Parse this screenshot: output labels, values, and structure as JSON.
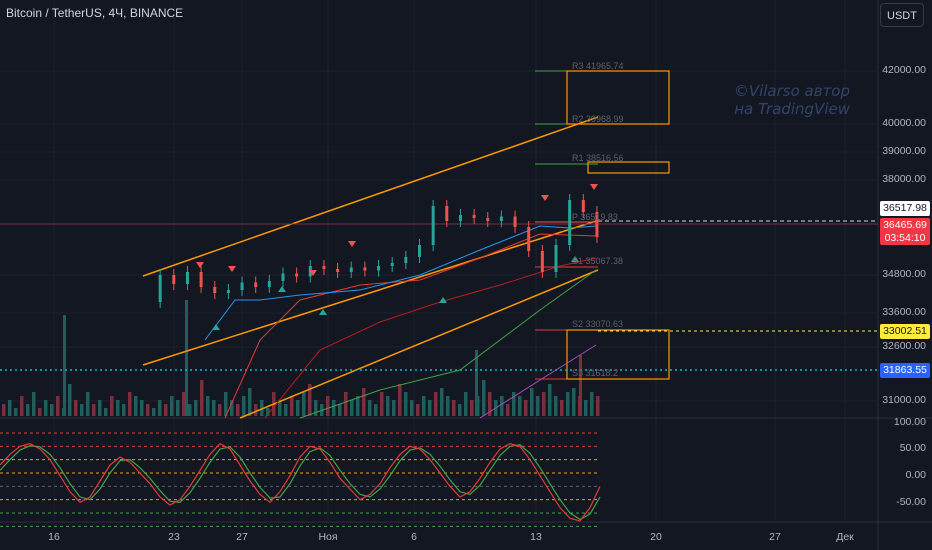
{
  "header": {
    "symbol": "Bitcoin / TetherUS, 4Ч, BINANCE",
    "currency": "USDT"
  },
  "watermark": {
    "line1": "©Vilarso автор",
    "line2": "на TradingView"
  },
  "price_axis": {
    "ticks": [
      "42000.00",
      "40000.00",
      "39000.00",
      "38000.00",
      "34800.00",
      "33600.00",
      "32600.00",
      "31000.00"
    ],
    "tags": {
      "level_a": {
        "value": "36517.98",
        "bg": "#ffffff",
        "fg": "#131722"
      },
      "last": {
        "value": "36465.69",
        "countdown": "03:54:10",
        "bg": "#f23645",
        "fg": "#ffffff"
      },
      "level_b": {
        "value": "33002.51",
        "bg": "#ffeb3b",
        "fg": "#131722"
      },
      "level_c": {
        "value": "31863.55",
        "bg": "#2962ff",
        "fg": "#ffffff"
      }
    }
  },
  "oscillator_axis": {
    "ticks": [
      "100.00",
      "50.00",
      "0.00",
      "-50.00"
    ]
  },
  "time_axis": {
    "ticks": [
      "16",
      "23",
      "27",
      "Ноя",
      "6",
      "13",
      "20",
      "27",
      "Дек"
    ]
  },
  "pivots": {
    "r3": "R3 41965.74",
    "r2": "R2 39968.99",
    "r1": "R1 38516.56",
    "p": "P 36519.83",
    "s1": "S1 35067.38",
    "s2": "S2 33070.63",
    "s3": "S3 31618.2"
  },
  "colors": {
    "background": "#131722",
    "channel": "#ff9800",
    "up": "#26a69a",
    "down": "#ef5350",
    "ma_red": "#e53935",
    "ma_dark_red": "#b71c1c",
    "ma_blue": "#2196f3",
    "ma_green": "#43a047",
    "stoch_k": "#e53935",
    "stoch_d": "#43a047"
  },
  "chart_data": {
    "type": "line",
    "title": "Bitcoin / TetherUS, 4Ч, BINANCE",
    "ylim": [
      30500,
      43000
    ],
    "price_path": [
      [
        0,
        34300
      ],
      [
        3,
        35200
      ],
      [
        6,
        34900
      ],
      [
        9,
        35300
      ],
      [
        12,
        34800
      ],
      [
        15,
        34600
      ],
      [
        18,
        34700
      ],
      [
        21,
        34950
      ],
      [
        24,
        34800
      ],
      [
        27,
        35000
      ],
      [
        30,
        35250
      ],
      [
        33,
        35150
      ],
      [
        36,
        35500
      ],
      [
        39,
        35400
      ],
      [
        42,
        35300
      ],
      [
        45,
        35450
      ],
      [
        48,
        35350
      ],
      [
        51,
        35500
      ],
      [
        54,
        35600
      ],
      [
        57,
        35800
      ],
      [
        60,
        36200
      ],
      [
        63,
        37500
      ],
      [
        66,
        37000
      ],
      [
        69,
        37200
      ],
      [
        72,
        37100
      ],
      [
        75,
        37000
      ],
      [
        78,
        37150
      ],
      [
        81,
        36800
      ],
      [
        84,
        36000
      ],
      [
        87,
        35300
      ],
      [
        90,
        36200
      ],
      [
        93,
        37700
      ],
      [
        96,
        37300
      ],
      [
        99,
        36465.69
      ]
    ],
    "volume": [
      3,
      4,
      2,
      5,
      3,
      6,
      2,
      4,
      3,
      5,
      2,
      8,
      4,
      3,
      6,
      3,
      4,
      2,
      5,
      4,
      3,
      6,
      5,
      4,
      3,
      2,
      4,
      3,
      5,
      4,
      6,
      3,
      4,
      9,
      5,
      4,
      3,
      6,
      4,
      3,
      5,
      7,
      3,
      4,
      2,
      6,
      4,
      3,
      5,
      4,
      6,
      8,
      4,
      3,
      5,
      4,
      3,
      6,
      4,
      5,
      7,
      4,
      3,
      6,
      5,
      4,
      8,
      6,
      4,
      3,
      5,
      4,
      6,
      7,
      5,
      4,
      3,
      6,
      4,
      5,
      9,
      6,
      4,
      5,
      3,
      6,
      5,
      4,
      7,
      5,
      6,
      8,
      5,
      4,
      6,
      7,
      5,
      4,
      6,
      5
    ],
    "stoch_k": [
      40,
      60,
      75,
      80,
      70,
      50,
      20,
      -10,
      -30,
      -20,
      10,
      40,
      55,
      45,
      25,
      5,
      -20,
      -35,
      -25,
      0,
      30,
      60,
      80,
      70,
      40,
      10,
      -15,
      -30,
      -10,
      20,
      55,
      75,
      70,
      45,
      15,
      -5,
      -25,
      -15,
      5,
      35,
      60,
      75,
      70,
      50,
      25,
      0,
      -20,
      -10,
      15,
      45,
      70,
      80,
      75,
      50,
      20,
      -10,
      -40,
      -60,
      -65,
      -40,
      0
    ],
    "stoch_d": [
      30,
      50,
      68,
      76,
      74,
      60,
      35,
      5,
      -20,
      -25,
      -5,
      25,
      48,
      50,
      35,
      15,
      -8,
      -28,
      -30,
      -12,
      15,
      45,
      70,
      74,
      55,
      25,
      -2,
      -22,
      -20,
      5,
      38,
      65,
      72,
      58,
      30,
      5,
      -15,
      -20,
      -5,
      20,
      48,
      68,
      72,
      60,
      38,
      12,
      -10,
      -15,
      2,
      30,
      58,
      75,
      78,
      62,
      35,
      5,
      -25,
      -50,
      -62,
      -52,
      -20
    ],
    "oscillator_ylim": [
      -80,
      110
    ]
  }
}
